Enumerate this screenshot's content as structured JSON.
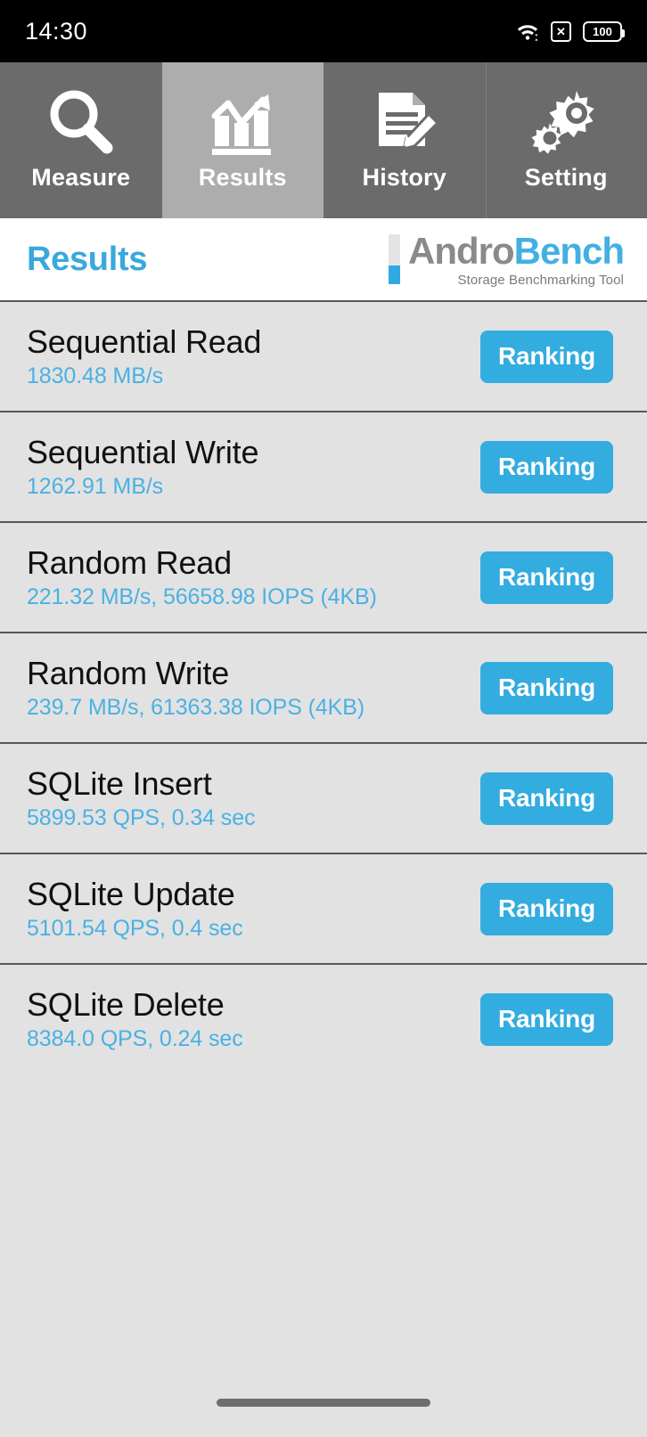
{
  "status_bar": {
    "clock": "14:30",
    "wifi_icon": "wifi-icon",
    "nosim_icon": "no-sim-icon",
    "nosim_glyph": "✕",
    "battery_level": "100"
  },
  "tabs": [
    {
      "label": "Measure",
      "icon": "magnifier-icon",
      "active": false
    },
    {
      "label": "Results",
      "icon": "bar-chart-trend-icon",
      "active": true
    },
    {
      "label": "History",
      "icon": "document-pencil-icon",
      "active": false
    },
    {
      "label": "Setting",
      "icon": "gears-icon",
      "active": false
    }
  ],
  "header": {
    "title": "Results",
    "logo_andro": "Andro",
    "logo_bench": "Bench",
    "logo_subtitle": "Storage Benchmarking Tool"
  },
  "results": [
    {
      "title": "Sequential Read",
      "value": "1830.48 MB/s",
      "button": "Ranking"
    },
    {
      "title": "Sequential Write",
      "value": "1262.91 MB/s",
      "button": "Ranking"
    },
    {
      "title": "Random Read",
      "value": "221.32 MB/s, 56658.98 IOPS (4KB)",
      "button": "Ranking"
    },
    {
      "title": "Random Write",
      "value": "239.7 MB/s, 61363.38 IOPS (4KB)",
      "button": "Ranking"
    },
    {
      "title": "SQLite Insert",
      "value": "5899.53 QPS, 0.34 sec",
      "button": "Ranking"
    },
    {
      "title": "SQLite Update",
      "value": "5101.54 QPS, 0.4 sec",
      "button": "Ranking"
    },
    {
      "title": "SQLite Delete",
      "value": "8384.0 QPS, 0.24 sec",
      "button": "Ranking"
    }
  ],
  "navigation_bar": {
    "handle": "gesture-home-handle"
  },
  "colors": {
    "accent_blue": "#33ace0",
    "value_blue": "#4bb1e3",
    "title_blue": "#39a8dd",
    "tab_inactive": "#6b6b6b",
    "tab_active": "#adadad",
    "list_bg": "#e2e2e2",
    "status_bg": "#000000"
  }
}
